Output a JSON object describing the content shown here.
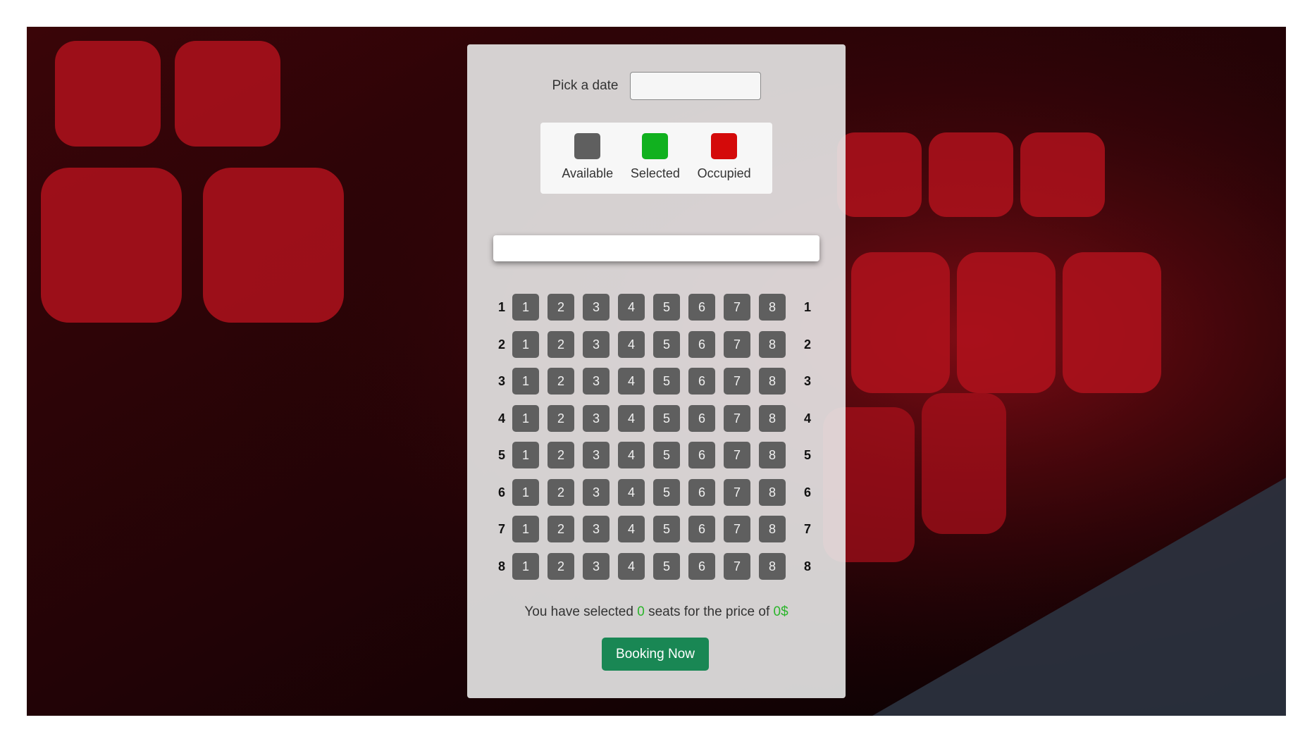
{
  "date_picker": {
    "label": "Pick a date",
    "value": "",
    "placeholder": ""
  },
  "legend": [
    {
      "label": "Available",
      "color": "#5f5f5f",
      "icon": "seat-available-swatch"
    },
    {
      "label": "Selected",
      "color": "#11b11f",
      "icon": "seat-selected-swatch"
    },
    {
      "label": "Occupied",
      "color": "#d40a0a",
      "icon": "seat-occupied-swatch"
    }
  ],
  "seat_colors": {
    "available": "#5f5f5f",
    "selected": "#11b11f",
    "occupied": "#d40a0a"
  },
  "seating": {
    "row_labels": [
      "1",
      "2",
      "3",
      "4",
      "5",
      "6",
      "7",
      "8"
    ],
    "seat_labels": [
      "1",
      "2",
      "3",
      "4",
      "5",
      "6",
      "7",
      "8"
    ],
    "rows": [
      [
        "available",
        "available",
        "available",
        "available",
        "available",
        "available",
        "available",
        "available"
      ],
      [
        "available",
        "available",
        "available",
        "available",
        "available",
        "available",
        "available",
        "available"
      ],
      [
        "available",
        "available",
        "available",
        "available",
        "available",
        "available",
        "available",
        "available"
      ],
      [
        "available",
        "available",
        "available",
        "available",
        "available",
        "available",
        "available",
        "available"
      ],
      [
        "available",
        "available",
        "available",
        "available",
        "available",
        "available",
        "available",
        "available"
      ],
      [
        "available",
        "available",
        "available",
        "available",
        "available",
        "available",
        "available",
        "available"
      ],
      [
        "available",
        "available",
        "available",
        "available",
        "available",
        "available",
        "available",
        "available"
      ],
      [
        "available",
        "available",
        "available",
        "available",
        "available",
        "available",
        "available",
        "available"
      ]
    ]
  },
  "summary": {
    "prefix": "You have selected",
    "count": "0",
    "middle": "seats for the price of",
    "price": "0$"
  },
  "book_button": {
    "label": "Booking Now",
    "color": "#198754"
  }
}
